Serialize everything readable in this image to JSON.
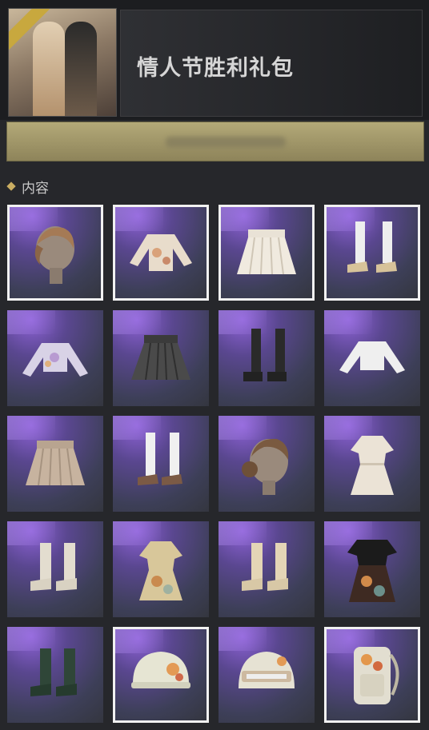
{
  "header": {
    "title": "情人节胜利礼包",
    "thumbnail_icon": "bundle-thumbnail",
    "accent_color": "#c8a83e"
  },
  "banner": {
    "text": ""
  },
  "section": {
    "label": "内容"
  },
  "items": [
    {
      "icon": "female-hair-braid-icon",
      "selected": true
    },
    {
      "icon": "floral-crop-top-icon",
      "selected": true
    },
    {
      "icon": "white-pleated-skirt-icon",
      "selected": true
    },
    {
      "icon": "white-socks-loafers-icon",
      "selected": true
    },
    {
      "icon": "floral-long-sleeve-top-icon",
      "selected": false
    },
    {
      "icon": "black-pleated-skirt-icon",
      "selected": false
    },
    {
      "icon": "black-knee-boots-icon",
      "selected": false
    },
    {
      "icon": "white-crop-top-icon",
      "selected": false
    },
    {
      "icon": "beige-pleated-skirt-icon",
      "selected": false
    },
    {
      "icon": "white-socks-brown-loafers-icon",
      "selected": false
    },
    {
      "icon": "female-hair-bun-icon",
      "selected": false
    },
    {
      "icon": "white-dress-icon",
      "selected": false
    },
    {
      "icon": "white-ankle-boots-icon",
      "selected": false
    },
    {
      "icon": "floral-dress-icon",
      "selected": false
    },
    {
      "icon": "cream-ankle-boots-icon",
      "selected": false
    },
    {
      "icon": "black-top-floral-skirt-icon",
      "selected": false
    },
    {
      "icon": "green-ankle-boots-icon",
      "selected": false
    },
    {
      "icon": "floral-helmet-icon",
      "selected": true
    },
    {
      "icon": "floral-visor-helmet-icon",
      "selected": false
    },
    {
      "icon": "floral-backpack-icon",
      "selected": true
    }
  ]
}
